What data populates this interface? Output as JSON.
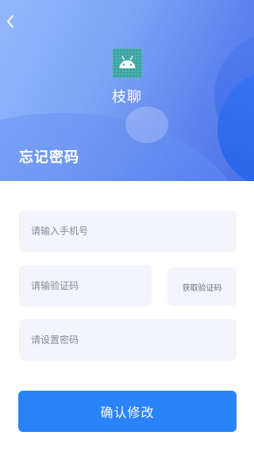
{
  "header": {
    "app_name": "枝聊",
    "page_title": "忘记密码",
    "back_icon": "chevron-left-icon",
    "logo_icon": "android-icon"
  },
  "form": {
    "phone_placeholder": "请输入手机号",
    "code_placeholder": "请输验证码",
    "get_code_label": "获取验证码",
    "password_placeholder": "请设置密码",
    "submit_label": "确认修改"
  },
  "colors": {
    "header_gradient_start": "#92b8fb",
    "header_gradient_end": "#4a6fe6",
    "field_background": "#f3f4fc",
    "primary_button": "#2b83fa",
    "logo_background": "#3ba4a1"
  }
}
